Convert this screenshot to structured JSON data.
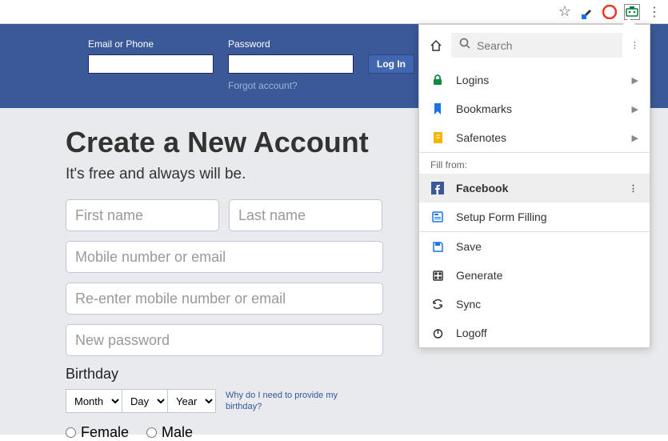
{
  "browser": {
    "star": "☆"
  },
  "fb_header": {
    "email_label": "Email or Phone",
    "password_label": "Password",
    "login_label": "Log In",
    "forgot_label": "Forgot account?"
  },
  "fb_main": {
    "title": "Create a New Account",
    "subtitle": "It's free and always will be.",
    "first_name_ph": "First name",
    "last_name_ph": "Last name",
    "mobile_ph": "Mobile number or email",
    "reenter_ph": "Re-enter mobile number or email",
    "password_ph": "New password",
    "birthday_label": "Birthday",
    "month": "Month",
    "day": "Day",
    "year": "Year",
    "bday_help": "Why do I need to provide my birthday?",
    "female": "Female",
    "male": "Male"
  },
  "ext": {
    "search_ph": "Search",
    "logins": "Logins",
    "bookmarks": "Bookmarks",
    "safenotes": "Safenotes",
    "fill_from": "Fill from:",
    "facebook": "Facebook",
    "setup_form": "Setup Form Filling",
    "save": "Save",
    "generate": "Generate",
    "sync": "Sync",
    "logoff": "Logoff"
  }
}
